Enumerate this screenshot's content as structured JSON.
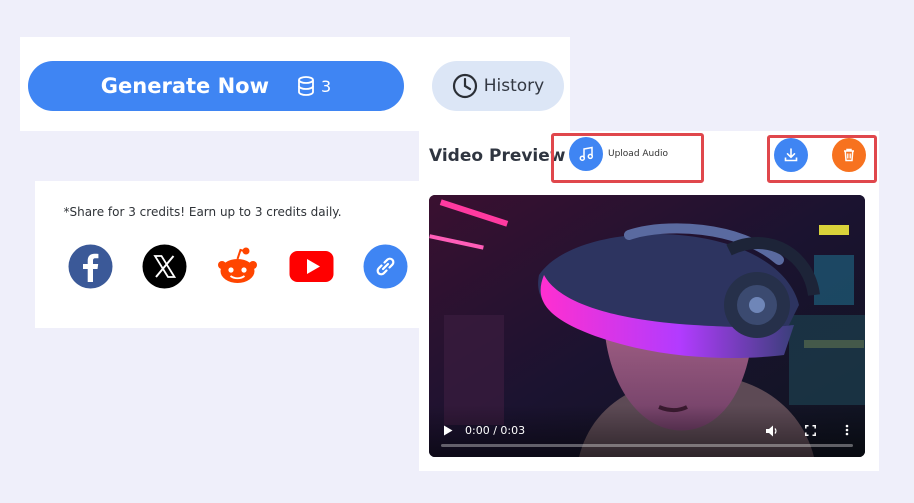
{
  "generate": {
    "label": "Generate Now",
    "credits": "3",
    "history_label": "History",
    "button_color": "#3f85f3"
  },
  "share": {
    "note": "*Share for 3 credits! Earn up to 3 credits daily.",
    "platforms": [
      {
        "icon": "facebook-icon",
        "color": "#3b5998"
      },
      {
        "icon": "x-icon",
        "color": "#000000"
      },
      {
        "icon": "reddit-icon",
        "color": "#ff4500"
      },
      {
        "icon": "youtube-icon",
        "color": "#ff0000"
      },
      {
        "icon": "link-icon",
        "color": "#3f85f3"
      }
    ]
  },
  "video_preview": {
    "title": "Video Preview",
    "upload_label": "Upload Audio",
    "download_icon": "download-icon",
    "delete_icon": "trash-icon",
    "delete_color": "#f7721f",
    "highlight_color": "#e0474c",
    "player": {
      "time": "0:00 / 0:03",
      "progress": 0
    }
  }
}
